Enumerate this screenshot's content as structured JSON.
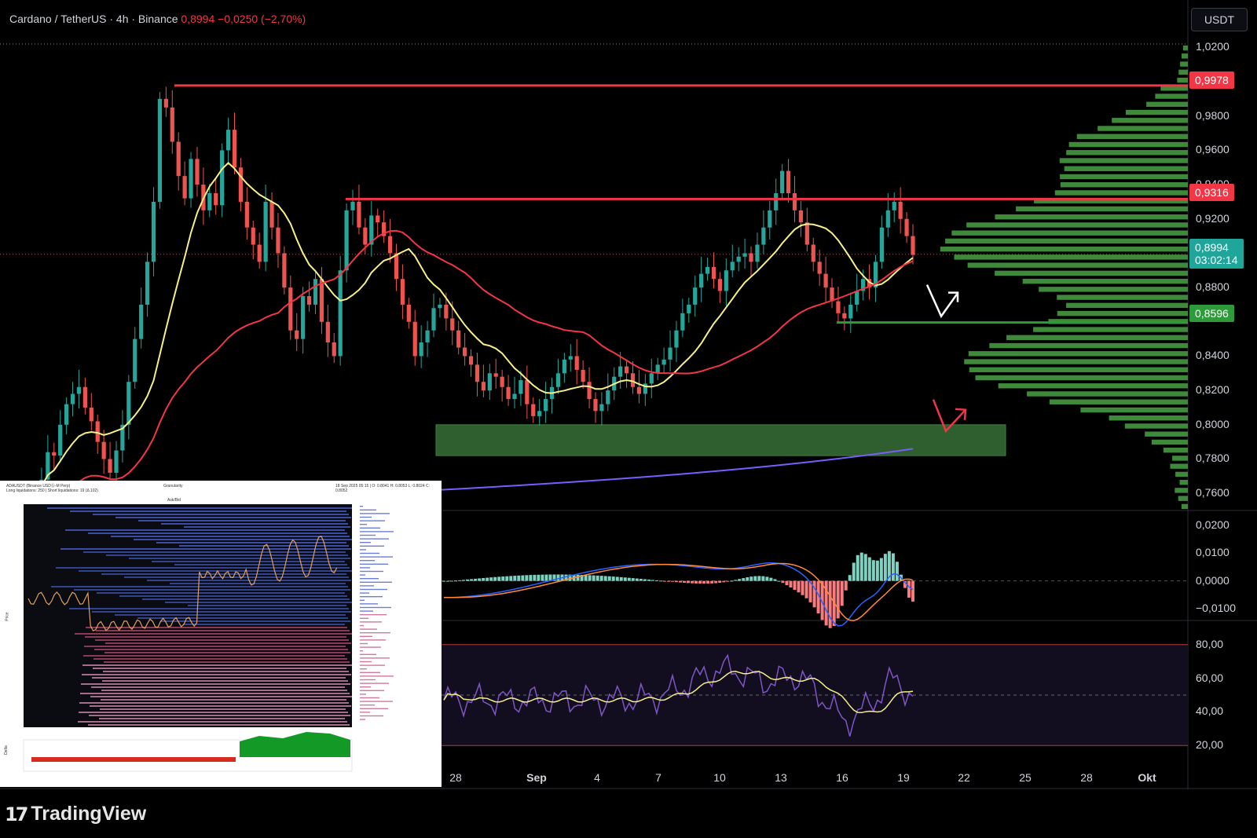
{
  "header": {
    "symbol": "Cardano / TetherUS · 4h · Binance",
    "price": "0,8994",
    "change": "−0,0250 (−2,70%)"
  },
  "currency_button": "USDT",
  "price_axis_ticks": [
    "1,0200",
    "0,9800",
    "0,9600",
    "0,9400",
    "0,9200",
    "0,8800",
    "0,8400",
    "0,8200",
    "0,8000",
    "0,7800",
    "0,7600"
  ],
  "macd_axis_ticks": [
    "0,0200",
    "0,0100",
    "0,0000",
    "−0,0100"
  ],
  "rsi_axis_ticks": [
    "80,00",
    "60,00",
    "40,00",
    "20,00"
  ],
  "time_axis_ticks": [
    "28",
    "Sep",
    "4",
    "7",
    "10",
    "13",
    "16",
    "19",
    "22",
    "25",
    "28",
    "Okt"
  ],
  "badges": {
    "resistance_high": "0,9978",
    "resistance_mid": "0,9316",
    "current_price": "0,8994",
    "countdown": "03:02:14",
    "support": "0,8596"
  },
  "colors": {
    "up_candle": "#26a69a",
    "down_candle": "#ef5350",
    "ma_fast": "#f5f08a",
    "ma_slow": "#f23645",
    "ma_long": "#7b5cff",
    "level_line": "#f23645",
    "support_line": "#2d9b3a",
    "volume_profile": "#3e8a3a",
    "demand_zone": "#2f5e2f"
  },
  "branding": "TradingView",
  "inset": {
    "title": "ADAUSDT (Binance USDⓈ-M Perp)",
    "subtitle": "Long liquidations: 250 | Short liquidations: 19 (Δ 102)",
    "info": "18 Sep 2025 05:15 | O: 0.8041 H: 0.8053 L: 0.8024 C: 0.8052",
    "control_1": "Granularity",
    "control_2": "Ask/Bid",
    "y_label": "Price",
    "delta_label": "Delta"
  },
  "chart_data": [
    {
      "type": "candlestick",
      "title": "Cardano / TetherUS · 4h · Binance",
      "ylim": [
        0.75,
        1.022
      ],
      "x_ticks": [
        "28",
        "Sep",
        "4",
        "7",
        "10",
        "13",
        "16",
        "19",
        "22",
        "25",
        "28",
        "Okt"
      ],
      "levels": [
        {
          "name": "resistance",
          "value": 0.9978
        },
        {
          "name": "resistance",
          "value": 0.9316
        },
        {
          "name": "support",
          "value": 0.8596
        }
      ],
      "zone": {
        "from": 0.782,
        "to": 0.8
      },
      "last_price": 0.8994,
      "close_path": [
        0.76,
        0.768,
        0.784,
        0.782,
        0.8,
        0.812,
        0.818,
        0.822,
        0.81,
        0.802,
        0.79,
        0.78,
        0.772,
        0.785,
        0.8,
        0.825,
        0.85,
        0.87,
        0.895,
        0.93,
        0.99,
        0.985,
        0.965,
        0.945,
        0.932,
        0.955,
        0.94,
        0.925,
        0.935,
        0.928,
        0.96,
        0.972,
        0.95,
        0.93,
        0.915,
        0.905,
        0.895,
        0.93,
        0.915,
        0.9,
        0.88,
        0.855,
        0.85,
        0.875,
        0.87,
        0.885,
        0.86,
        0.848,
        0.84,
        0.89,
        0.925,
        0.93,
        0.915,
        0.905,
        0.922,
        0.918,
        0.91,
        0.9,
        0.885,
        0.87,
        0.86,
        0.84,
        0.848,
        0.855,
        0.868,
        0.87,
        0.862,
        0.855,
        0.845,
        0.84,
        0.835,
        0.825,
        0.82,
        0.83,
        0.828,
        0.822,
        0.815,
        0.818,
        0.826,
        0.812,
        0.805,
        0.808,
        0.815,
        0.822,
        0.83,
        0.838,
        0.84,
        0.832,
        0.825,
        0.815,
        0.808,
        0.812,
        0.82,
        0.828,
        0.834,
        0.83,
        0.822,
        0.818,
        0.824,
        0.83,
        0.835,
        0.838,
        0.845,
        0.855,
        0.865,
        0.87,
        0.88,
        0.888,
        0.892,
        0.885,
        0.878,
        0.89,
        0.895,
        0.898,
        0.9,
        0.895,
        0.905,
        0.915,
        0.925,
        0.935,
        0.948,
        0.935,
        0.925,
        0.918,
        0.905,
        0.895,
        0.888,
        0.88,
        0.872,
        0.865,
        0.862,
        0.87,
        0.878,
        0.885,
        0.88,
        0.895,
        0.915,
        0.925,
        0.93,
        0.92,
        0.91,
        0.899
      ]
    },
    {
      "type": "line",
      "title": "MACD",
      "ylim": [
        -0.012,
        0.022
      ],
      "zero_line": 0
    },
    {
      "type": "line",
      "title": "RSI",
      "ylim": [
        15,
        85
      ],
      "bands": [
        80,
        50,
        20
      ]
    }
  ]
}
